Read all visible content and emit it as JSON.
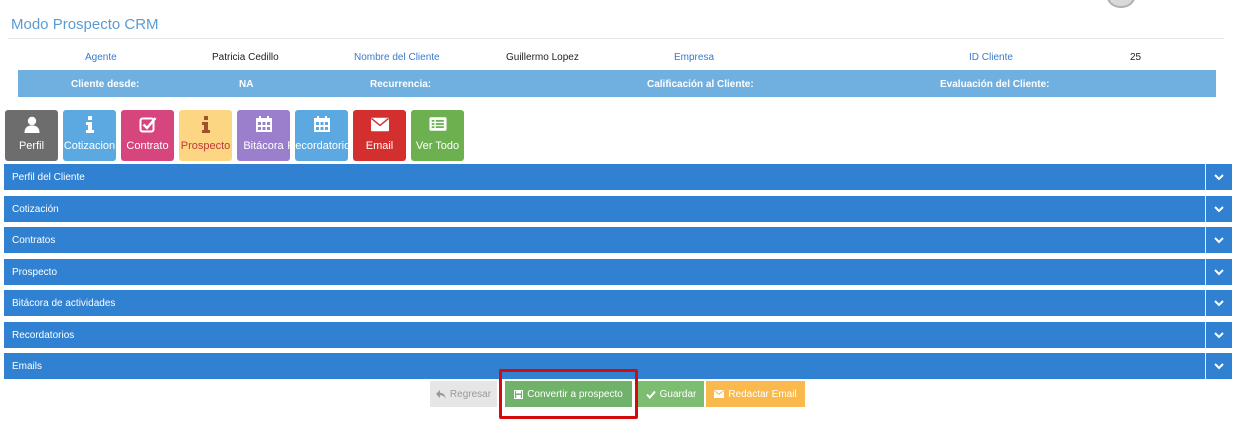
{
  "page": {
    "title": "Modo Prospecto CRM"
  },
  "info_row1": {
    "agente_label": "Agente",
    "agente_value": "Patricia Cedillo",
    "cliente_label": "Nombre del Cliente",
    "cliente_value": "Guillermo Lopez",
    "empresa_label": "Empresa",
    "id_label": "ID Cliente",
    "id_value": "25"
  },
  "info_row2": {
    "cliente_desde_label": "Cliente desde:",
    "cliente_desde_value": "NA",
    "recurrencia_label": "Recurrencia:",
    "calificacion_label": "Calificación al Cliente:",
    "evaluacion_label": "Evaluación del Cliente:"
  },
  "tabs": [
    {
      "label": "Perfil",
      "icon": "user-icon",
      "color": "#6d6d6d"
    },
    {
      "label": "Cotizacion",
      "icon": "info-icon",
      "color": "#5ba9e0"
    },
    {
      "label": "Contrato",
      "icon": "check-square-icon",
      "color": "#d6457e"
    },
    {
      "label": "Prospecto",
      "icon": "info-icon",
      "color": "#fcd683"
    },
    {
      "label": "Bitácora",
      "icon": "calendar-icon",
      "color": "#9b7fcc"
    },
    {
      "label": "Recordatorios",
      "icon": "calendar-icon",
      "color": "#5ba9e0"
    },
    {
      "label": "Email",
      "icon": "envelope-icon",
      "color": "#d32f2f"
    },
    {
      "label": "Ver Todo",
      "icon": "list-icon",
      "color": "#6cb04f"
    }
  ],
  "accordion": [
    {
      "label": "Perfil del Cliente"
    },
    {
      "label": "Cotización"
    },
    {
      "label": "Contratos"
    },
    {
      "label": "Prospecto"
    },
    {
      "label": "Bitácora de actividades"
    },
    {
      "label": "Recordatorios"
    },
    {
      "label": "Emails"
    }
  ],
  "actions": {
    "regresar": "Regresar",
    "convertir": "Convertir a prospecto",
    "guardar": "Guardar",
    "redactar": "Redactar Email"
  },
  "colors": {
    "accordion_bg": "#3081d1",
    "info_bar_bg": "#6fb0e0",
    "highlight": "#d40b0b"
  }
}
